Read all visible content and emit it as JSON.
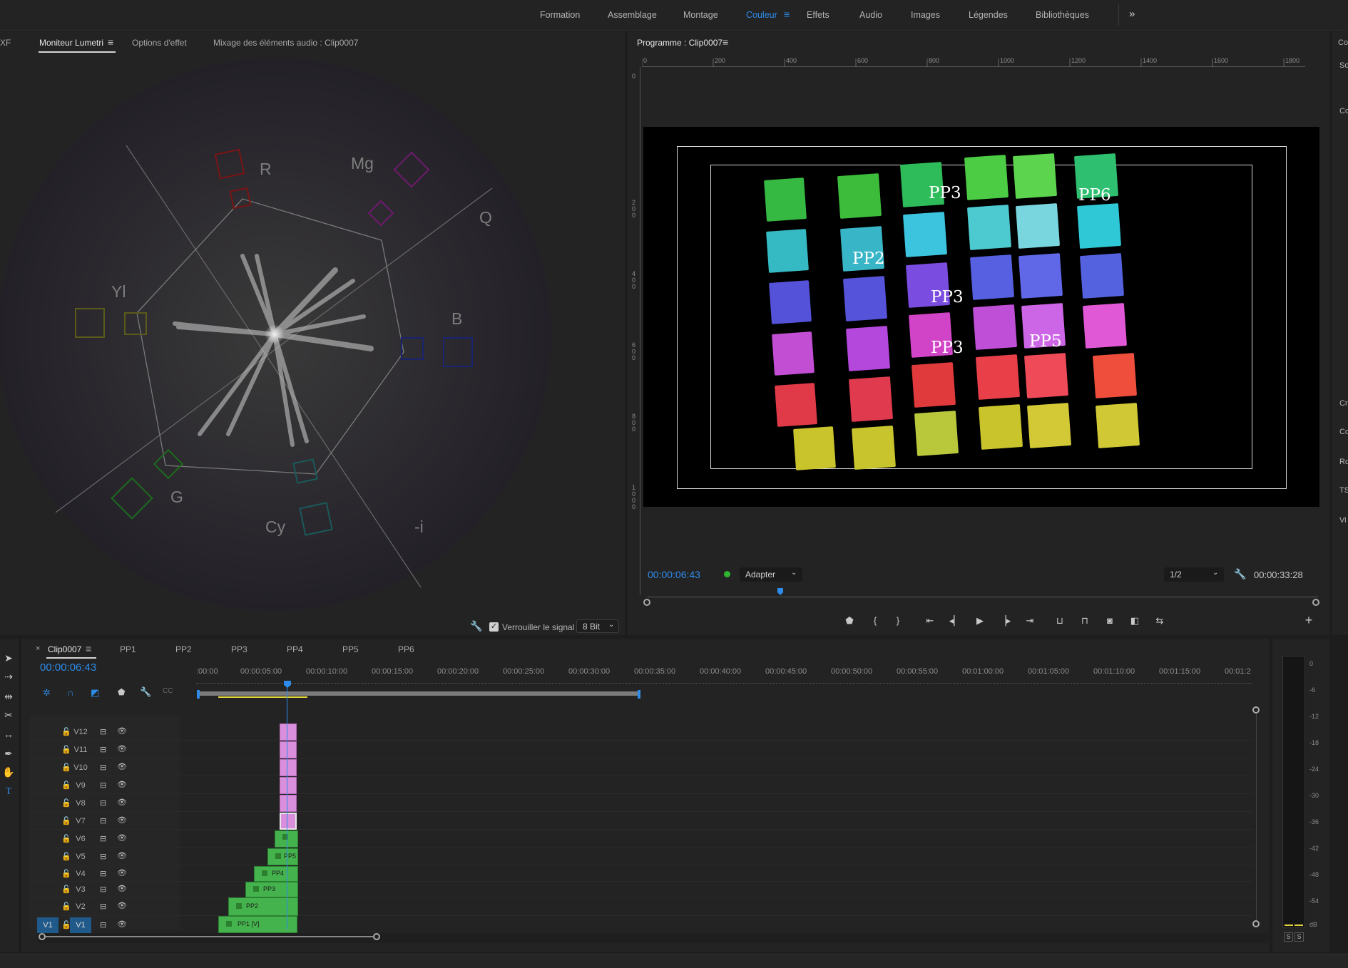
{
  "workspaces": [
    "Formation",
    "Assemblage",
    "Montage",
    "Couleur",
    "Effets",
    "Audio",
    "Images",
    "Légendes",
    "Bibliothèques"
  ],
  "workspace_active": "Couleur",
  "workspace_overflow": "»",
  "left_panel": {
    "cut_tab": "XF",
    "tabs": [
      "Moniteur Lumetri",
      "Options d'effet",
      "Mixage des éléments audio : Clip0007"
    ],
    "scope_labels": {
      "r": "R",
      "mg": "Mg",
      "q": "Q",
      "yl": "Yl",
      "b": "B",
      "g": "G",
      "cy": "Cy",
      "minus_i": "-i"
    },
    "lock_signal_label": "Verrouiller le signal",
    "lock_signal_checked": true,
    "bit_depth": "8 Bit"
  },
  "program_monitor": {
    "title": "Programme : Clip0007",
    "ruler_h": [
      "0",
      "200",
      "400",
      "600",
      "800",
      "1000",
      "1200",
      "1400",
      "1600",
      "1800"
    ],
    "ruler_v": [
      "0",
      "2 0 0",
      "4 0 0",
      "6 0 0",
      "8 0 0",
      "1 0 0 0"
    ],
    "overlay_labels": [
      "PP3",
      "PP6",
      "PP2",
      "PP3",
      "PP3",
      "PP5"
    ],
    "timecode": "00:00:06:43",
    "fit": "Adapter",
    "resolution": "1/2",
    "duration": "00:00:33:28"
  },
  "timeline": {
    "sequence_tabs": [
      "Clip0007",
      "PP1",
      "PP2",
      "PP3",
      "PP4",
      "PP5",
      "PP6"
    ],
    "timecode": "00:00:06:43",
    "ruler": [
      ":00:00",
      "00:00:05:00",
      "00:00:10:00",
      "00:00:15:00",
      "00:00:20:00",
      "00:00:25:00",
      "00:00:30:00",
      "00:00:35:00",
      "00:00:40:00",
      "00:00:45:00",
      "00:00:50:00",
      "00:00:55:00",
      "00:01:00:00",
      "00:01:05:00",
      "00:01:10:00",
      "00:01:15:00",
      "00:01:2"
    ],
    "tracks": [
      "V12",
      "V11",
      "V10",
      "V9",
      "V8",
      "V7",
      "V6",
      "V5",
      "V4",
      "V3",
      "V2",
      "V1"
    ],
    "source_patch": "V1",
    "clips": {
      "v5": "PP5",
      "v4": "PP4",
      "v3": "PP3",
      "v2": "PP2",
      "v1": "PP1 [V]"
    }
  },
  "audio_meter": {
    "scale": [
      "0",
      "-6",
      "-12",
      "-18",
      "-24",
      "-30",
      "-36",
      "-42",
      "-48",
      "-54",
      "dB"
    ],
    "solo": [
      "S",
      "S"
    ]
  },
  "right_edge": [
    "Co",
    "So",
    "Co",
    "Cr",
    "Co",
    "Ro",
    "TS",
    "Vi"
  ]
}
